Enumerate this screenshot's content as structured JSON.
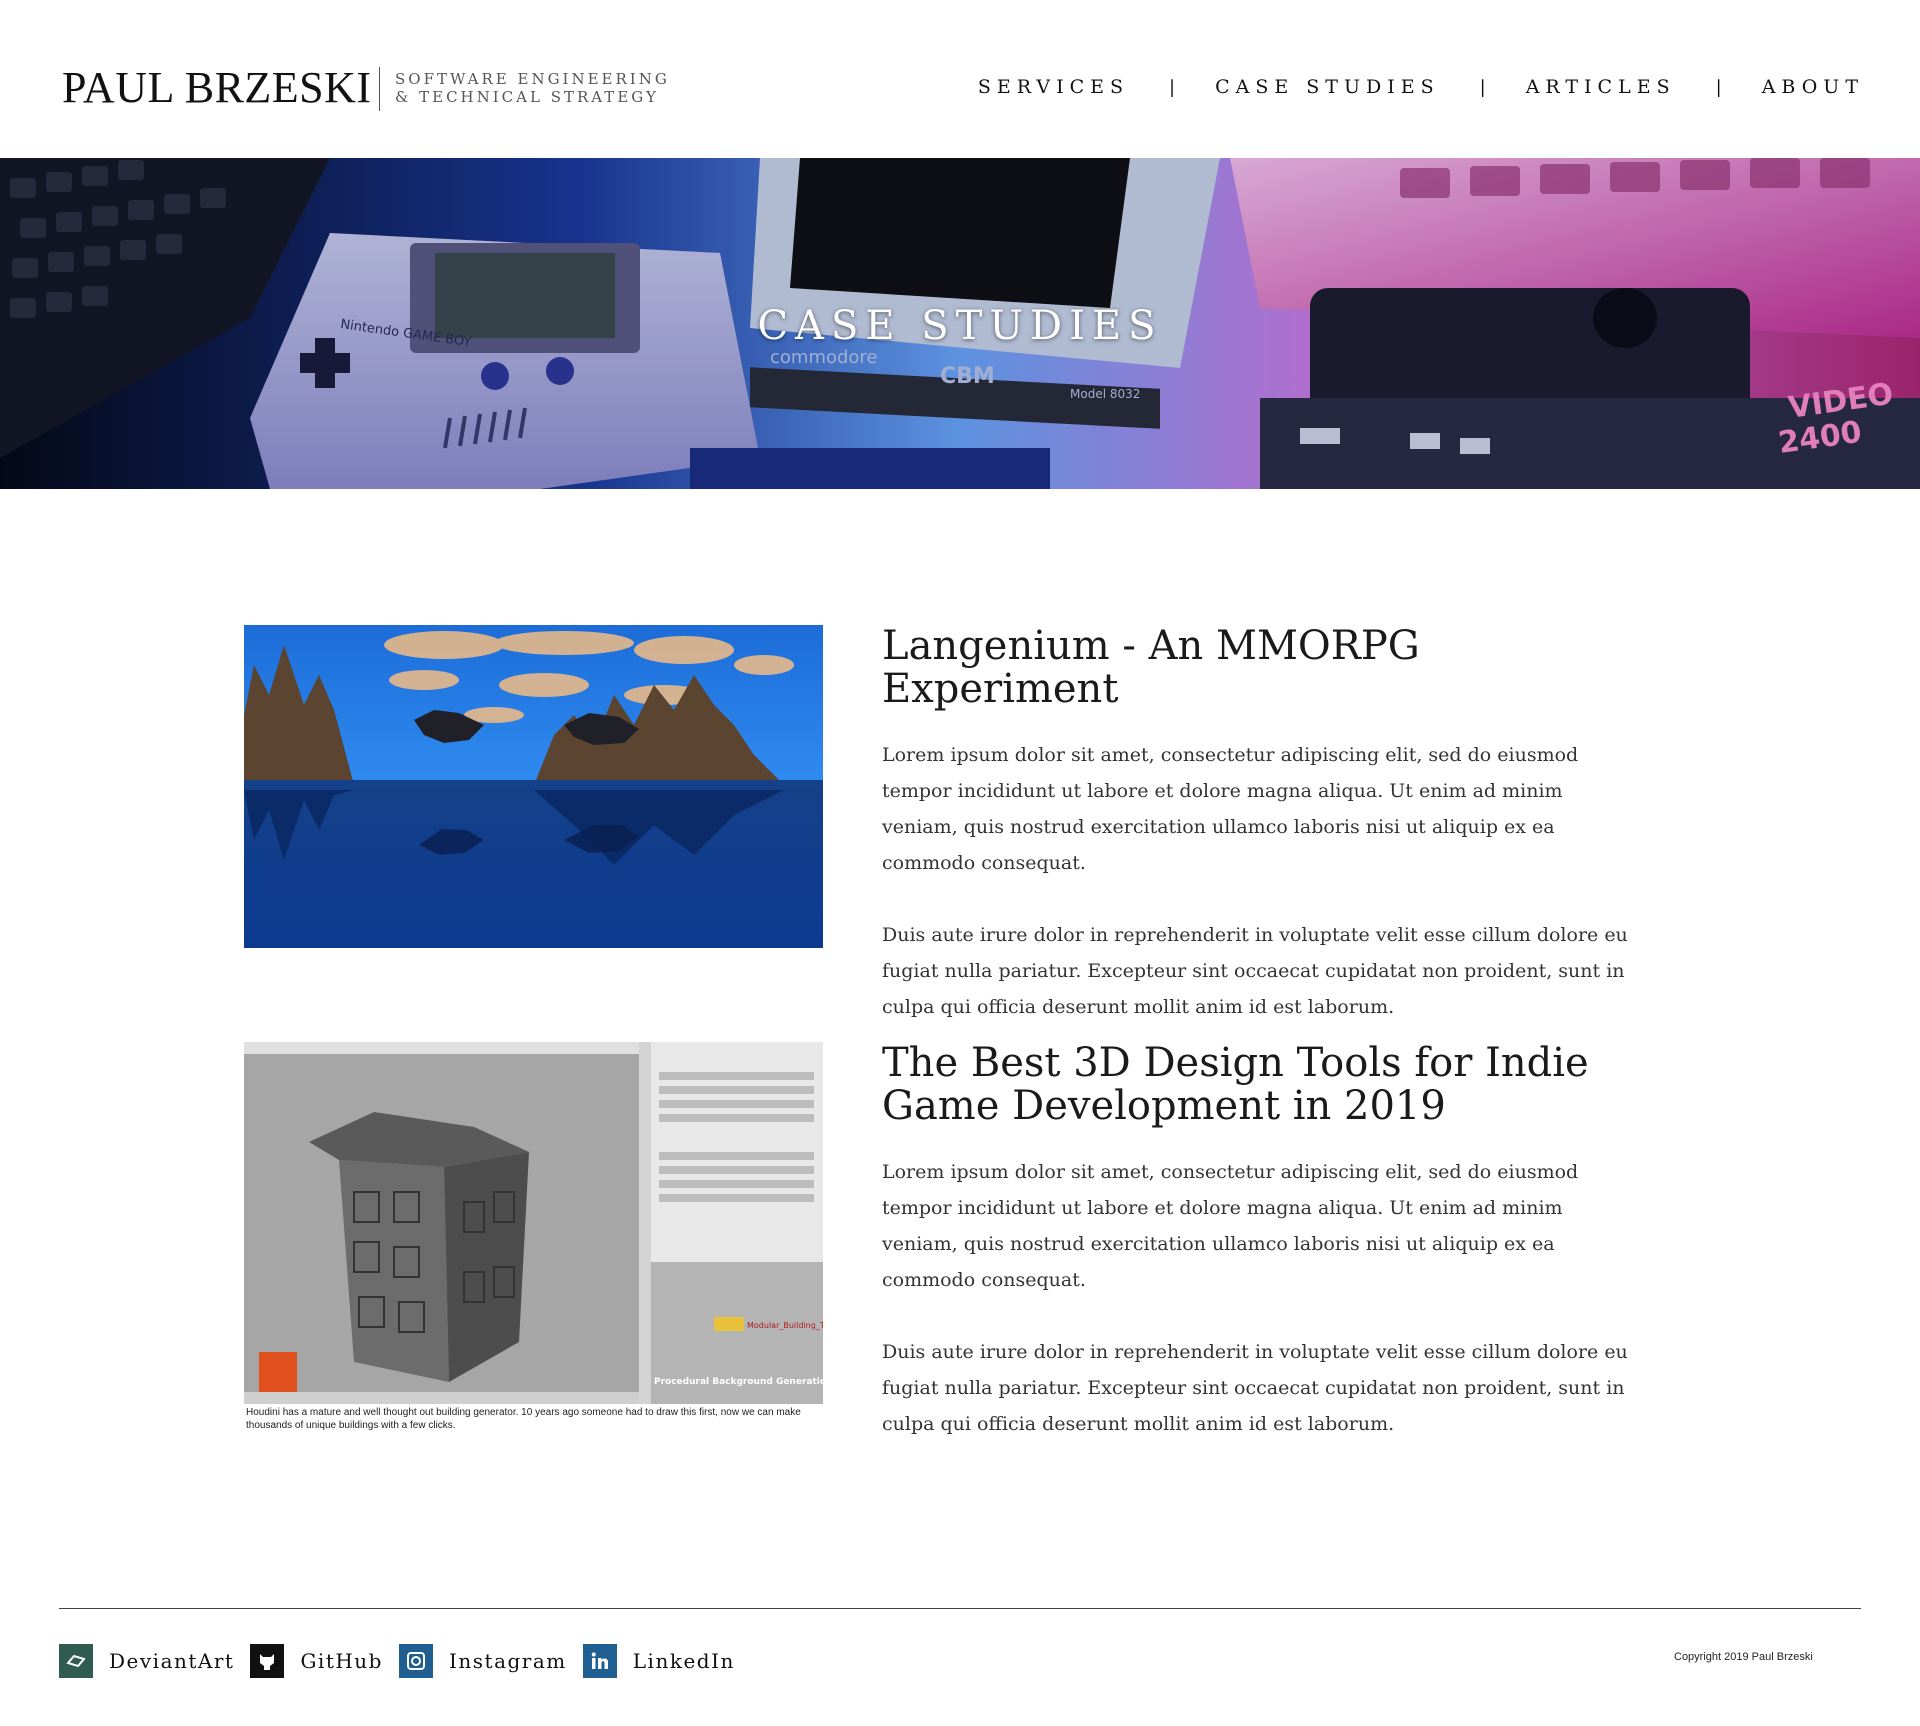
{
  "brand": {
    "name": "PAUL BRZESKI",
    "tagline_line1": "SOFTWARE ENGINEERING",
    "tagline_line2": "& TECHNICAL STRATEGY"
  },
  "nav": {
    "items": [
      "SERVICES",
      "CASE STUDIES",
      "ARTICLES",
      "ABOUT"
    ],
    "separator": "|"
  },
  "hero": {
    "title": "CASE STUDIES",
    "photo_labels": {
      "gameboy": "Nintendo GAME BOY",
      "commodore": "commodore",
      "cbm": "CBM",
      "model": "Model 8032",
      "video": "VIDEO",
      "video_number": "2400"
    }
  },
  "articles": [
    {
      "title": "Langenium - An MMORPG Experiment",
      "paragraphs": [
        "Lorem ipsum dolor sit amet, consectetur adipiscing elit, sed do eiusmod tempor incididunt ut labore et dolore magna aliqua. Ut enim ad minim veniam, quis nostrud exercitation ullamco laboris nisi ut aliquip ex ea commodo consequat.",
        "Duis aute irure dolor in reprehenderit in voluptate velit esse cillum dolore eu fugiat nulla pariatur. Excepteur sint occaecat cupidatat non proident, sunt in culpa qui officia deserunt mollit anim id est laborum."
      ]
    },
    {
      "title": "The Best 3D Design Tools for Indie Game Development in 2019",
      "paragraphs": [
        "Lorem ipsum dolor sit amet, consectetur adipiscing elit, sed do eiusmod tempor incididunt ut labore et dolore magna aliqua. Ut enim ad minim veniam, quis nostrud exercitation ullamco laboris nisi ut aliquip ex ea commodo consequat.",
        "Duis aute irure dolor in reprehenderit in voluptate velit esse cillum dolore eu fugiat nulla pariatur. Excepteur sint occaecat cupidatat non proident, sunt in culpa qui officia deserunt mollit anim id est laborum."
      ],
      "image": {
        "caption": "Houdini has a mature and well thought out building generator. 10 years ago someone had to draw this first, now we can make thousands of unique buildings with a few clicks.",
        "overlay_title": "Procedural Background Generation",
        "node_label": "Modular_Building_Tool"
      }
    }
  ],
  "footer": {
    "social": [
      {
        "label": "DeviantArt",
        "icon": "deviantart-icon",
        "color": "#2f5b50"
      },
      {
        "label": "GitHub",
        "icon": "github-icon",
        "color": "#111111"
      },
      {
        "label": "Instagram",
        "icon": "instagram-icon",
        "color": "#1f5f91"
      },
      {
        "label": "LinkedIn",
        "icon": "linkedin-icon",
        "color": "#1f5f91"
      }
    ],
    "copyright": "Copyright 2019 Paul Brzeski"
  }
}
